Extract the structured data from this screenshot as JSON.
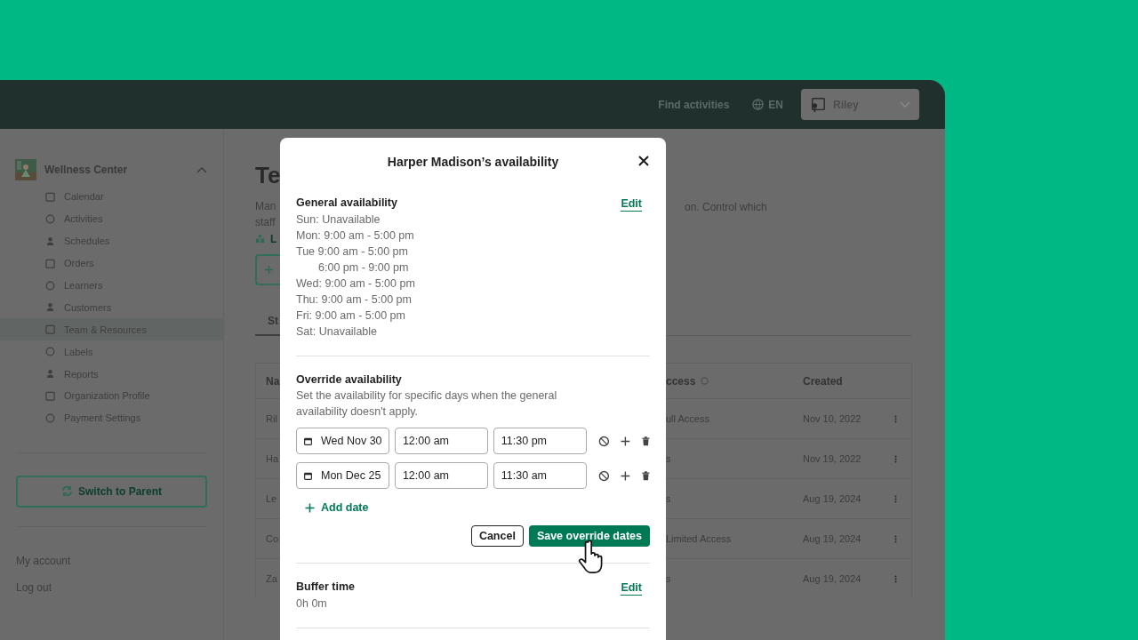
{
  "header": {
    "links": [
      "Find activities"
    ],
    "language": "EN",
    "user_menu": {
      "name": "Riley"
    }
  },
  "sidebar": {
    "organization": "Wellness Center",
    "expanded": true,
    "items": [
      {
        "label": "Calendar",
        "selected": false
      },
      {
        "label": "Activities",
        "selected": false
      },
      {
        "label": "Schedules",
        "selected": false
      },
      {
        "label": "Orders",
        "selected": false
      },
      {
        "label": "Learners",
        "selected": false
      },
      {
        "label": "Customers",
        "selected": false
      },
      {
        "label": "Team & Resources",
        "selected": true
      },
      {
        "label": "Labels",
        "selected": false
      },
      {
        "label": "Reports",
        "selected": false
      },
      {
        "label": "Organization Profile",
        "selected": false
      },
      {
        "label": "Payment Settings",
        "selected": false
      }
    ],
    "switch_button": "Switch to Parent",
    "account_links": [
      "My account",
      "Log out"
    ]
  },
  "main": {
    "title": "Te",
    "description_left": [
      "Man",
      "staff"
    ],
    "description_right": "on. Control which",
    "link": "L",
    "tab": "St",
    "table": {
      "columns": {
        "left": "Na",
        "access": "ccess",
        "created": "Created"
      },
      "rows": [
        {
          "name": "Ril",
          "access": "ull Access",
          "created": "Nov 10, 2022"
        },
        {
          "name": "Ha",
          "access": "s",
          "created": "Nov 19, 2022"
        },
        {
          "name": "Le",
          "access": "s",
          "created": "Aug 19, 2024"
        },
        {
          "name": "Co",
          "access": "Limited Access",
          "created": "Aug 19, 2024"
        },
        {
          "name": "Za",
          "access": "s",
          "created": "Aug 19, 2024"
        }
      ]
    }
  },
  "modal": {
    "title": "Harper Madison’s availability",
    "general": {
      "heading": "General availability",
      "edit": "Edit",
      "lines": [
        {
          "text": "Sun: Unavailable",
          "kind": "day"
        },
        {
          "text": "Mon: 9:00 am - 5:00 pm",
          "kind": "day"
        },
        {
          "text": "Tue 9:00 am - 5:00 pm",
          "kind": "day"
        },
        {
          "text": "6:00 pm - 9:00 pm",
          "kind": "continuation"
        },
        {
          "text": "Wed: 9:00 am - 5:00 pm",
          "kind": "day"
        },
        {
          "text": "Thu: 9:00 am - 5:00 pm",
          "kind": "day"
        },
        {
          "text": "Fri: 9:00 am - 5:00 pm",
          "kind": "day"
        },
        {
          "text": "Sat: Unavailable",
          "kind": "day"
        }
      ]
    },
    "override": {
      "heading": "Override availability",
      "description": "Set the availability for specific days when the general availability doesn't apply.",
      "rows": [
        {
          "date": "Wed Nov 30",
          "start": "12:00 am",
          "end": "11:30 pm"
        },
        {
          "date": "Mon Dec 25",
          "start": "12:00 am",
          "end": "11:30 am"
        }
      ],
      "add": "Add date",
      "cancel": "Cancel",
      "save": "Save override dates"
    },
    "buffer": {
      "heading": "Buffer time",
      "value": "0h 0m",
      "edit": "Edit"
    }
  }
}
